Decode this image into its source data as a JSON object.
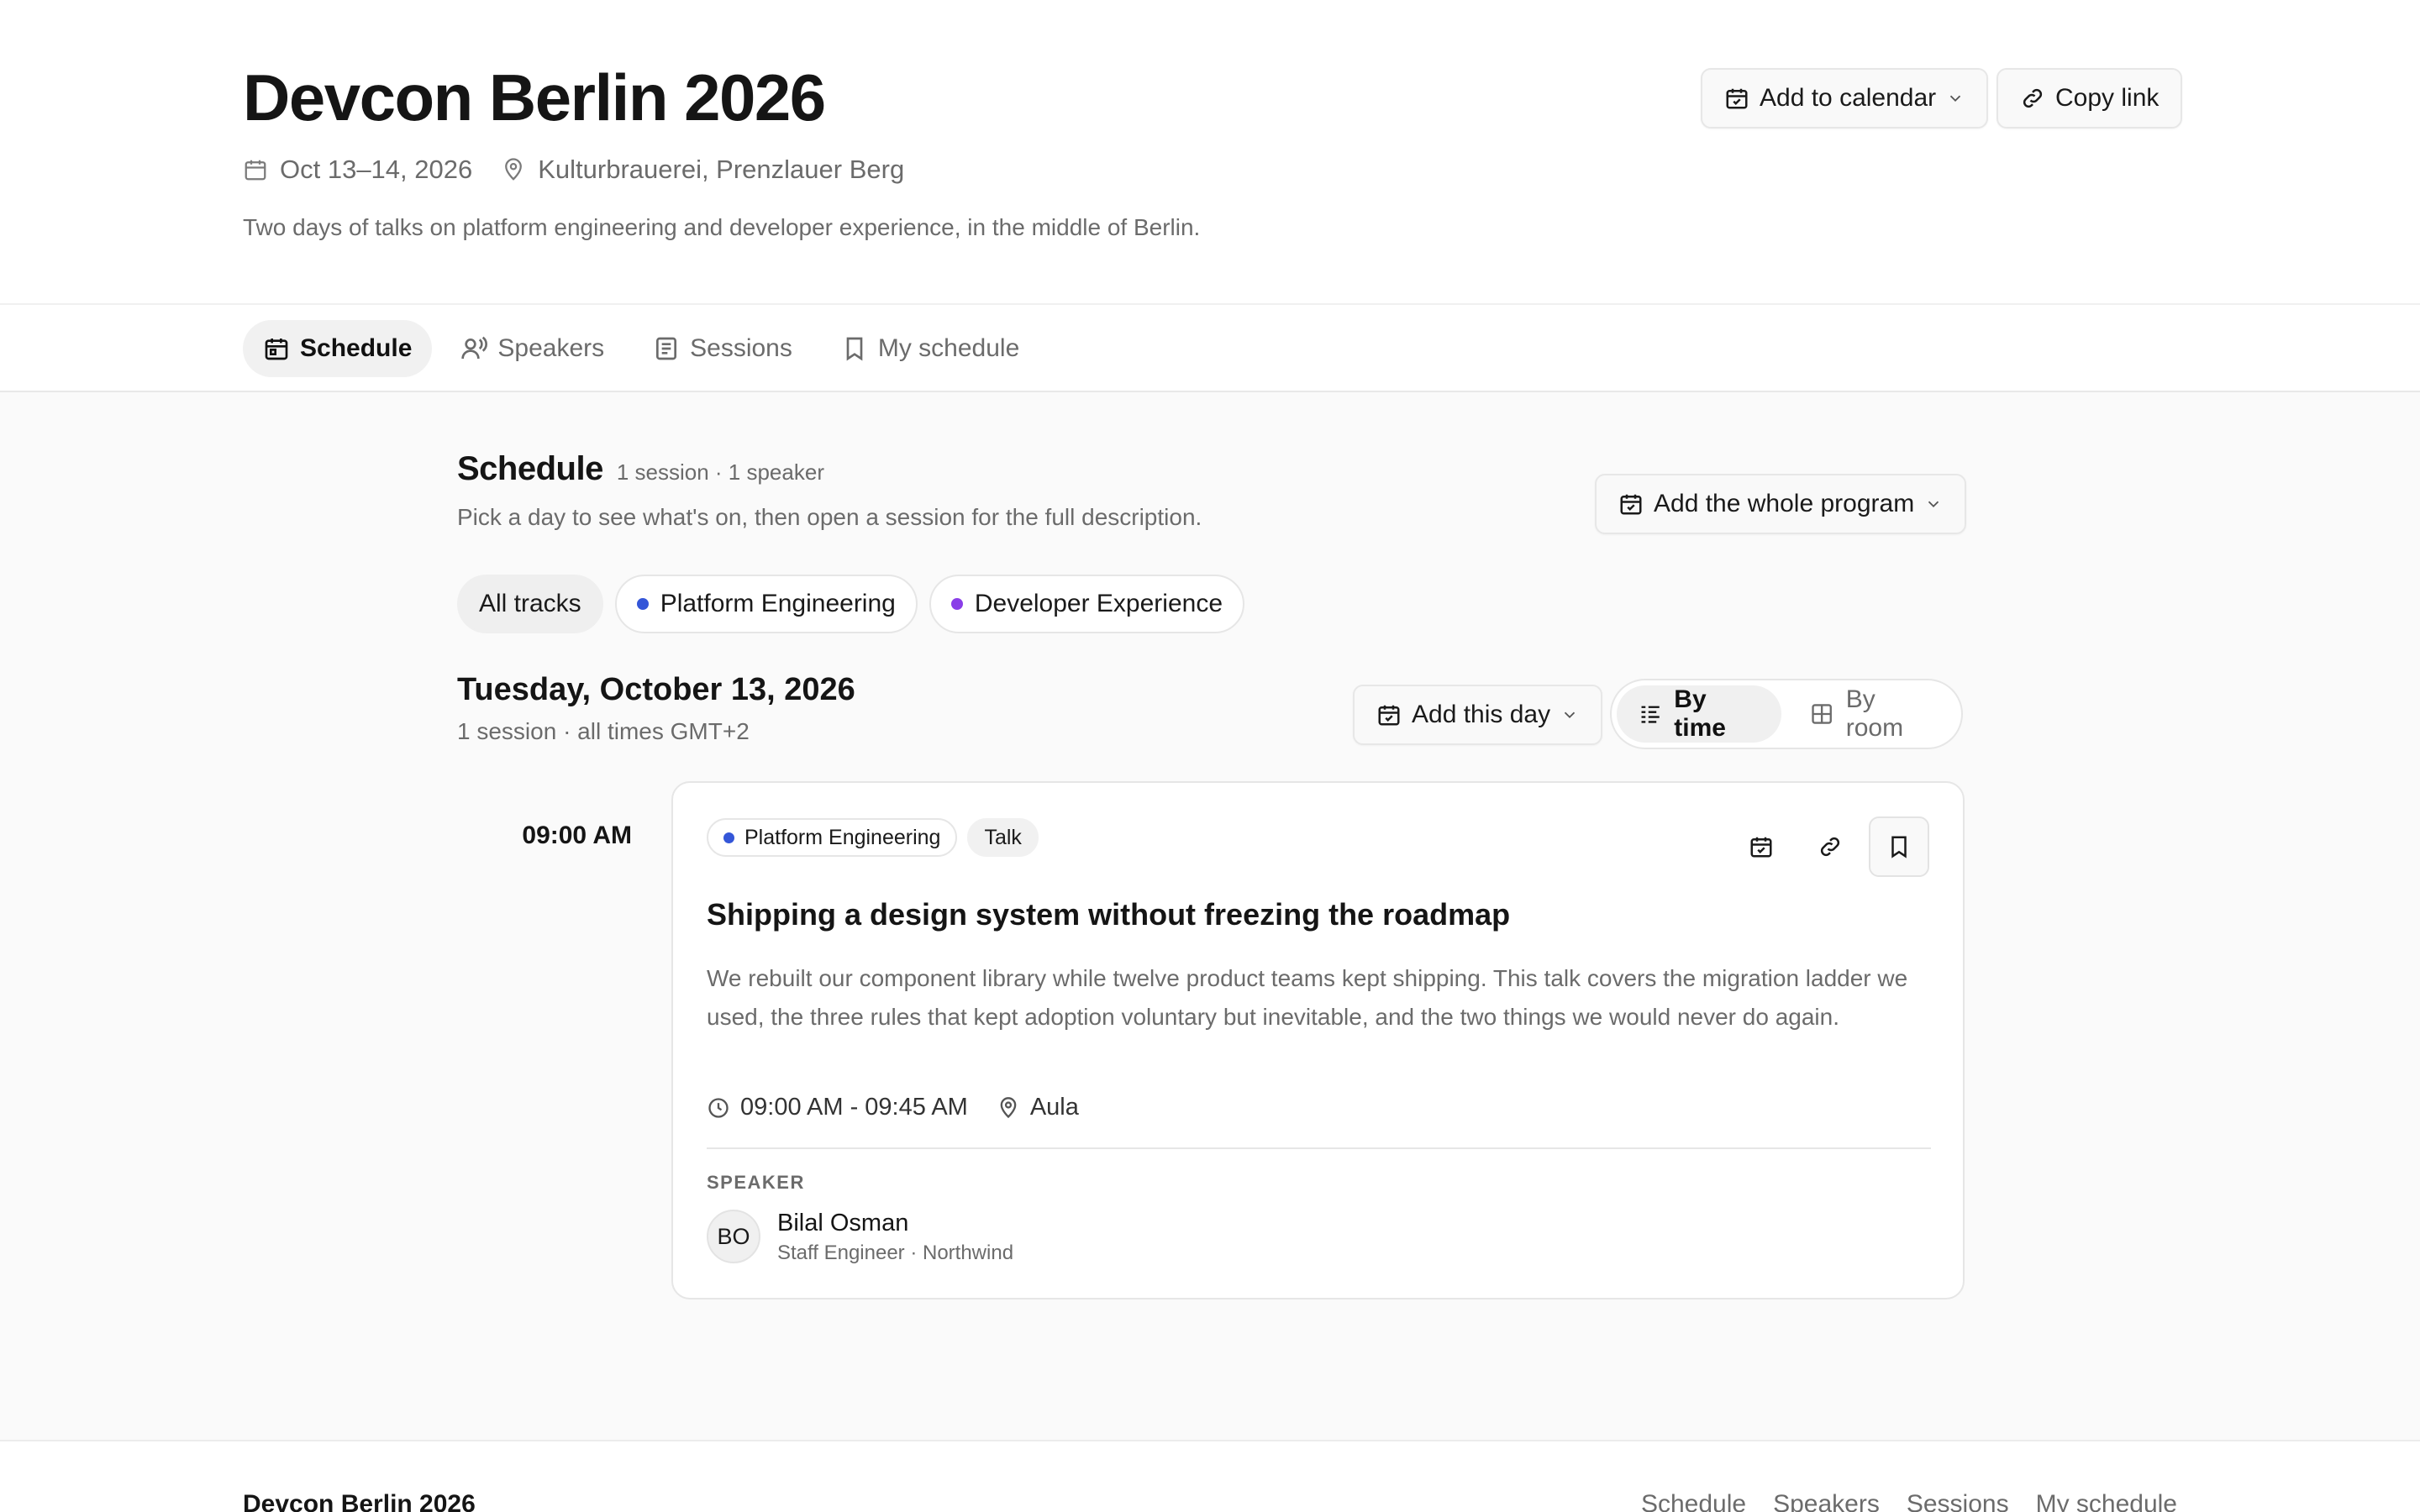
{
  "event": {
    "title": "Devcon Berlin 2026",
    "dates": "Oct 13–14, 2026",
    "venue": "Kulturbrauerei, Prenzlauer Berg",
    "description": "Two days of talks on platform engineering and developer experience, in the middle of Berlin."
  },
  "header_actions": {
    "add_to_calendar": "Add to calendar",
    "copy_link": "Copy link"
  },
  "nav": {
    "tabs": [
      {
        "label": "Schedule",
        "icon": "calendar-icon",
        "active": true
      },
      {
        "label": "Speakers",
        "icon": "speaker-icon",
        "active": false
      },
      {
        "label": "Sessions",
        "icon": "document-icon",
        "active": false
      },
      {
        "label": "My schedule",
        "icon": "bookmark-icon",
        "active": false
      }
    ]
  },
  "schedule": {
    "title": "Schedule",
    "counts": "1 session · 1 speaker",
    "subtitle": "Pick a day to see what's on, then open a session for the full description.",
    "add_program": "Add the whole program"
  },
  "filters": {
    "all": "All tracks",
    "tracks": [
      {
        "label": "Platform Engineering",
        "color": "#3456d8"
      },
      {
        "label": "Developer Experience",
        "color": "#8a3ee8"
      }
    ]
  },
  "day": {
    "title": "Tuesday, October 13, 2026",
    "subtitle": "1 session · all times GMT+2",
    "add_day": "Add this day",
    "view_by_time": "By time",
    "view_by_room": "By room"
  },
  "session": {
    "time": "09:00 AM",
    "track": "Platform Engineering",
    "track_color": "#3456d8",
    "type": "Talk",
    "title": "Shipping a design system without freezing the roadmap",
    "description": "We rebuilt our component library while twelve product teams kept shipping. This talk covers the migration ladder we used, the three rules that kept adoption voluntary but inevitable, and the two things we would never do again.",
    "time_range": "09:00 AM - 09:45 AM",
    "room": "Aula",
    "speaker_label": "SPEAKER",
    "speaker": {
      "initials": "BO",
      "name": "Bilal Osman",
      "role": "Staff Engineer · Northwind"
    }
  },
  "footer": {
    "title": "Devcon Berlin 2026",
    "links": [
      "Schedule",
      "Speakers",
      "Sessions",
      "My schedule"
    ]
  }
}
